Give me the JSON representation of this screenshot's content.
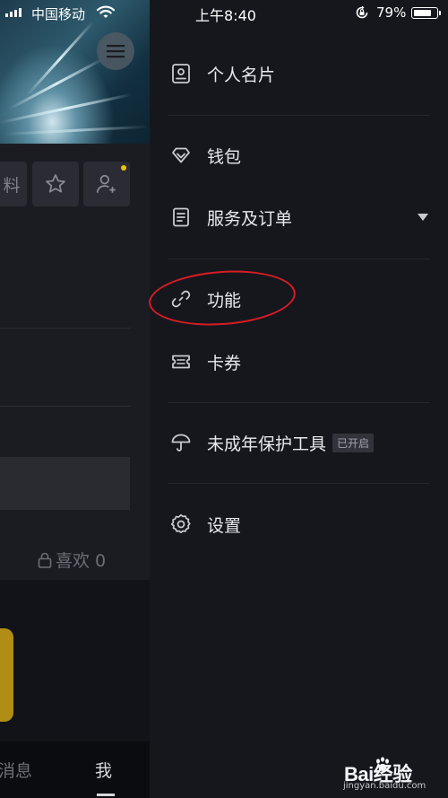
{
  "status_bar": {
    "carrier": "中国移动",
    "time": "上午8:40",
    "battery": "79%",
    "battery_level": 0.79
  },
  "profile_page": {
    "edit_partial": "料",
    "likes_label": "喜欢 0",
    "nav": {
      "messages": "消息",
      "me": "我"
    }
  },
  "drawer": {
    "items": [
      {
        "label": "个人名片",
        "icon": "id-card-icon"
      },
      {
        "label": "钱包",
        "icon": "wallet-diamond-icon"
      },
      {
        "label": "服务及订单",
        "icon": "order-list-icon"
      },
      {
        "label": "功能",
        "icon": "link-icon"
      },
      {
        "label": "卡券",
        "icon": "ticket-icon"
      },
      {
        "label": "未成年保护工具",
        "icon": "umbrella-icon",
        "badge": "已开启"
      },
      {
        "label": "设置",
        "icon": "gear-icon"
      }
    ]
  },
  "watermark": {
    "brand": "Bai经验",
    "url": "jingyan.baidu.com"
  },
  "colors": {
    "highlight_circle": "#d91c24",
    "notification_dot": "#f2c200"
  }
}
